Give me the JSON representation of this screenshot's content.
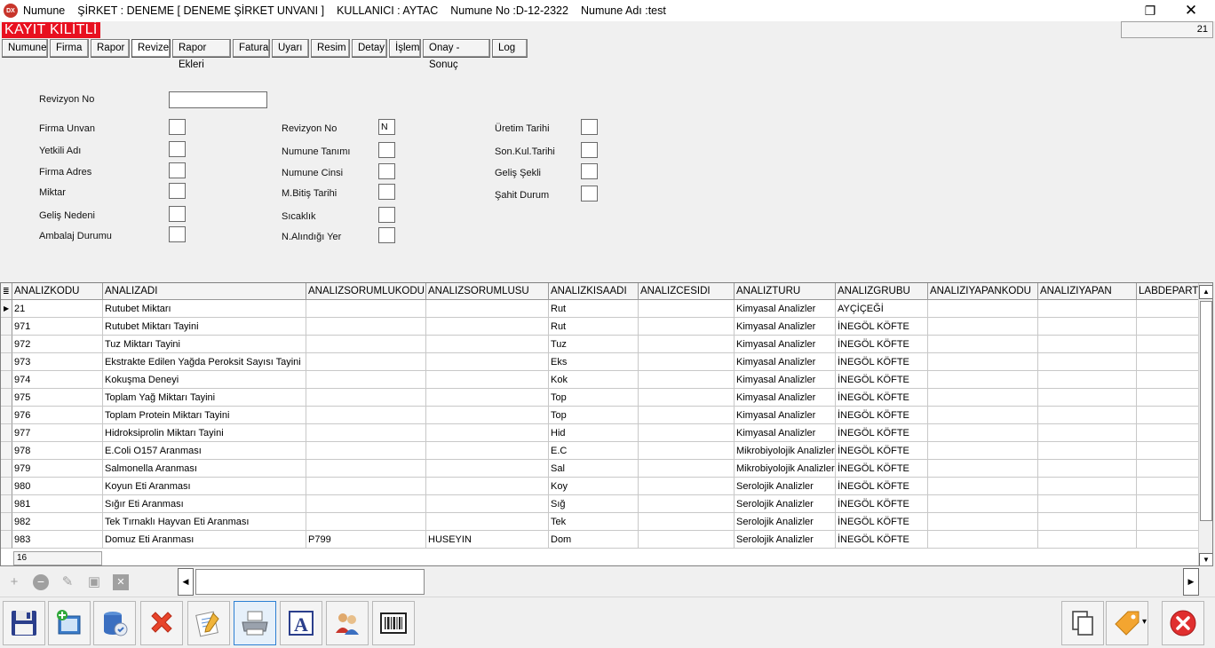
{
  "titlebar": {
    "icon_text": "DX",
    "app": "Numune",
    "company": "ŞİRKET : DENEME [ DENEME ŞİRKET UNVANI ]",
    "user": "KULLANICI : AYTAC",
    "sample_no": "Numune No :D-12-2322",
    "sample_name": "Numune Adı :test",
    "maximize_glyph": "❐",
    "close_glyph": "✕"
  },
  "lock": {
    "label": "KAYIT KİLİTLİ",
    "record_count": "21"
  },
  "tabs": [
    "Numune",
    "Firma",
    "Rapor",
    "Revize",
    "Rapor Ekleri",
    "Fatura",
    "Uyarı",
    "Resim",
    "Detay",
    "İşlem",
    "Onay - Sonuç",
    "Log"
  ],
  "active_tab": "Revize",
  "form": {
    "revision_no_label": "Revizyon No",
    "col1": [
      "Firma Unvan",
      "Yetkili Adı",
      "Firma Adres",
      "Miktar",
      "Geliş Nedeni",
      "Ambalaj Durumu"
    ],
    "col2": [
      "Revizyon No",
      "Numune Tanımı",
      "Numune Cinsi",
      "M.Bitiş Tarihi",
      "Sıcaklık",
      "N.Alındığı Yer"
    ],
    "col3": [
      "Üretim Tarihi",
      "Son.Kul.Tarihi",
      "Geliş Şekli",
      "Şahit Durum"
    ],
    "revizyon_no_value": "N"
  },
  "grid": {
    "columns": [
      "ANALIZKODU",
      "ANALIZADI",
      "ANALIZSORUMLUKODU",
      "ANALIZSORUMLUSU",
      "ANALIZKISAADI",
      "ANALIZCESIDI",
      "ANALIZTURU",
      "ANALIZGRUBU",
      "ANALIZIYAPANKODU",
      "ANALIZIYAPAN",
      "LABDEPARTM"
    ],
    "rows": [
      [
        "21",
        "Rutubet Miktarı",
        "",
        "",
        "Rut",
        "",
        "Kimyasal Analizler",
        "AYÇİÇEĞİ",
        "",
        "",
        ""
      ],
      [
        "971",
        "Rutubet Miktarı Tayini",
        "",
        "",
        "Rut",
        "",
        "Kimyasal Analizler",
        "İNEGÖL KÖFTE",
        "",
        "",
        ""
      ],
      [
        "972",
        "Tuz Miktarı Tayini",
        "",
        "",
        "Tuz",
        "",
        "Kimyasal Analizler",
        "İNEGÖL KÖFTE",
        "",
        "",
        ""
      ],
      [
        "973",
        "Ekstrakte Edilen Yağda Peroksit Sayısı Tayini",
        "",
        "",
        "Eks",
        "",
        "Kimyasal Analizler",
        "İNEGÖL KÖFTE",
        "",
        "",
        ""
      ],
      [
        "974",
        "Kokuşma Deneyi",
        "",
        "",
        "Kok",
        "",
        "Kimyasal Analizler",
        "İNEGÖL KÖFTE",
        "",
        "",
        ""
      ],
      [
        "975",
        "Toplam Yağ Miktarı Tayini",
        "",
        "",
        "Top",
        "",
        "Kimyasal Analizler",
        "İNEGÖL KÖFTE",
        "",
        "",
        ""
      ],
      [
        "976",
        "Toplam Protein Miktarı Tayini",
        "",
        "",
        "Top",
        "",
        "Kimyasal Analizler",
        "İNEGÖL KÖFTE",
        "",
        "",
        ""
      ],
      [
        "977",
        "Hidroksiprolin Miktarı Tayini",
        "",
        "",
        "Hid",
        "",
        "Kimyasal Analizler",
        "İNEGÖL KÖFTE",
        "",
        "",
        ""
      ],
      [
        "978",
        "E.Coli O157 Aranması",
        "",
        "",
        "E.C",
        "",
        "Mikrobiyolojik Analizler",
        "İNEGÖL KÖFTE",
        "",
        "",
        ""
      ],
      [
        "979",
        "Salmonella Aranması",
        "",
        "",
        "Sal",
        "",
        "Mikrobiyolojik Analizler",
        "İNEGÖL KÖFTE",
        "",
        "",
        ""
      ],
      [
        "980",
        "Koyun Eti Aranması",
        "",
        "",
        "Koy",
        "",
        "Serolojik Analizler",
        "İNEGÖL KÖFTE",
        "",
        "",
        ""
      ],
      [
        "981",
        "Sığır Eti Aranması",
        "",
        "",
        "Sığ",
        "",
        "Serolojik Analizler",
        "İNEGÖL KÖFTE",
        "",
        "",
        ""
      ],
      [
        "982",
        "Tek Tırnaklı Hayvan Eti Aranması",
        "",
        "",
        "Tek",
        "",
        "Serolojik Analizler",
        "İNEGÖL KÖFTE",
        "",
        "",
        ""
      ],
      [
        "983",
        "Domuz Eti Aranması",
        "P799",
        "HUSEYIN",
        "Dom",
        "",
        "Serolojik Analizler",
        "İNEGÖL KÖFTE",
        "",
        "",
        ""
      ]
    ],
    "footer_count": "16"
  },
  "navigator": {
    "add": "+",
    "delete": "−",
    "edit": "✎",
    "save": "▣",
    "cancel": "✕",
    "scroll_left": "◀",
    "scroll_right": "▶",
    "scroll_up": "▲",
    "scroll_down": "▼",
    "row_pointer": "▶",
    "header_menu": "≣"
  },
  "toolbar_icons": [
    "save-icon",
    "new-record-icon",
    "database-icon",
    "delete-icon",
    "edit-document-icon",
    "printer-icon",
    "text-icon",
    "users-icon",
    "barcode-icon",
    "copy-icon",
    "tag-icon",
    "close-icon"
  ],
  "toolbar_glyphs": {
    "text": "A",
    "dropdown": "▾"
  },
  "colors": {
    "lock_red": "#e8101f",
    "active_blue": "#2c7fd3",
    "delete_red": "#e8442a"
  }
}
